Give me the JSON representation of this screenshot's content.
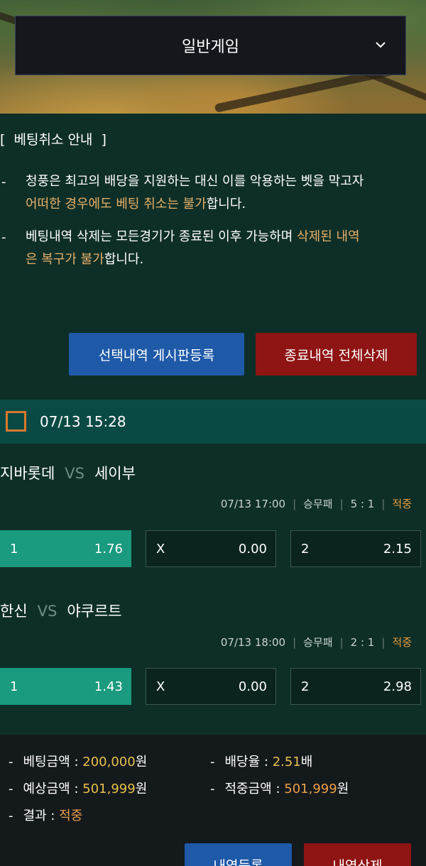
{
  "header": {
    "game_select_label": "일반게임"
  },
  "notice": {
    "title": "[  베팅취소 안내  ]",
    "items": [
      {
        "line1": "청풍은 최고의 배당을 지원하는 대신 이를 악용하는 벳을 막고자",
        "highlight": "어떠한 경우에도 베팅 취소는 불가",
        "rest": "합니다."
      },
      {
        "line1_pre": "베팅내역 삭제는 모든경기가 종료된 이후 가능하며 ",
        "highlight_a": "삭제된 내역",
        "highlight_b": "은 복구가 불가",
        "rest": "합니다."
      }
    ],
    "btn_register": "선택내역 게시판등록",
    "btn_delete_all": "종료내역 전체삭제"
  },
  "slip": {
    "datetime": "07/13 15:28",
    "vs_label": "VS",
    "matches": [
      {
        "home": "지바롯데",
        "away": "세이부",
        "time": "07/13 17:00",
        "type": "승무패",
        "score": "5 : 1",
        "result": "적중",
        "odds": [
          {
            "label": "1",
            "value": "1.76"
          },
          {
            "label": "X",
            "value": "0.00"
          },
          {
            "label": "2",
            "value": "2.15"
          }
        ]
      },
      {
        "home": "한신",
        "away": "야쿠르트",
        "time": "07/13 18:00",
        "type": "승무패",
        "score": "2 : 1",
        "result": "적중",
        "odds": [
          {
            "label": "1",
            "value": "1.43"
          },
          {
            "label": "X",
            "value": "0.00"
          },
          {
            "label": "2",
            "value": "2.98"
          }
        ]
      }
    ]
  },
  "summary": {
    "bet_amount_label": "베팅금액 : ",
    "bet_amount_value": "200,000",
    "bet_amount_unit": "원",
    "odds_rate_label": "배당율 : ",
    "odds_rate_value": "2.51",
    "odds_rate_unit": "배",
    "expected_label": "예상금액 : ",
    "expected_value": "501,999",
    "expected_unit": "원",
    "hit_amount_label": "적중금액 : ",
    "hit_amount_value": "501,999",
    "hit_amount_unit": "원",
    "result_label": "결과 : ",
    "result_value": "적중",
    "dash": "-",
    "btn_register": "내역등록",
    "btn_delete": "내역삭제"
  },
  "colors": {
    "background": "#0e2f27",
    "highlight": "#e7b069",
    "button_blue": "#1f5aa8",
    "button_red": "#8f1414",
    "odd_selected": "#1a9a7e",
    "result_hit": "#e79a3c"
  }
}
